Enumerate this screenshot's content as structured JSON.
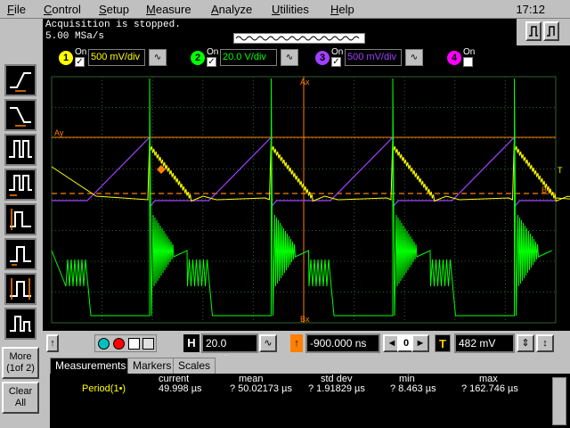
{
  "menu": {
    "items": [
      "File",
      "Control",
      "Setup",
      "Measure",
      "Analyze",
      "Utilities",
      "Help"
    ],
    "clock": "17:12"
  },
  "status": {
    "line1": "Acquisition is stopped.",
    "line2": "5.00 MSa/s"
  },
  "channels": [
    {
      "num": "1",
      "on_label": "On",
      "checked": true,
      "scale": "500 mV/div",
      "color": "#ffff00"
    },
    {
      "num": "2",
      "on_label": "On",
      "checked": true,
      "scale": "20.0 V/div",
      "color": "#00ff00"
    },
    {
      "num": "3",
      "on_label": "On",
      "checked": true,
      "scale": "500 mV/div",
      "color": "#a040ff"
    },
    {
      "num": "4",
      "on_label": "On",
      "checked": false,
      "scale": "",
      "color": "#ff00ff"
    }
  ],
  "left_toolbar": {
    "more_label": "More",
    "more_sub": "(1of 2)",
    "clear_label": "Clear",
    "clear_sub": "All"
  },
  "scope": {
    "markers": {
      "ax": "Ax",
      "bx": "Bx",
      "ay": "Ay",
      "by": "By",
      "t": "T"
    },
    "colors": {
      "grid": "#2f5f2f",
      "ch1": "#ffff00",
      "ch2": "#00ff00",
      "ch3": "#a040ff",
      "marker": "#ff8000"
    }
  },
  "controls": {
    "h_label": "H",
    "timebase": "20.0 µs/div",
    "delay": "-900.000 ns",
    "zero": "0",
    "t_label": "T",
    "trigger_level": "482 mV"
  },
  "measurements": {
    "tabs": [
      "Measurements",
      "Markers",
      "Scales"
    ],
    "active_tab": "Measurements",
    "headers": [
      "current",
      "mean",
      "std dev",
      "min",
      "max"
    ],
    "row": {
      "name": "Period(1•)",
      "current": "49.998 µs",
      "mean": "? 50.02173 µs",
      "stddev": "? 1.91829 µs",
      "min": "? 8.463 µs",
      "max": "? 162.746 µs"
    }
  }
}
